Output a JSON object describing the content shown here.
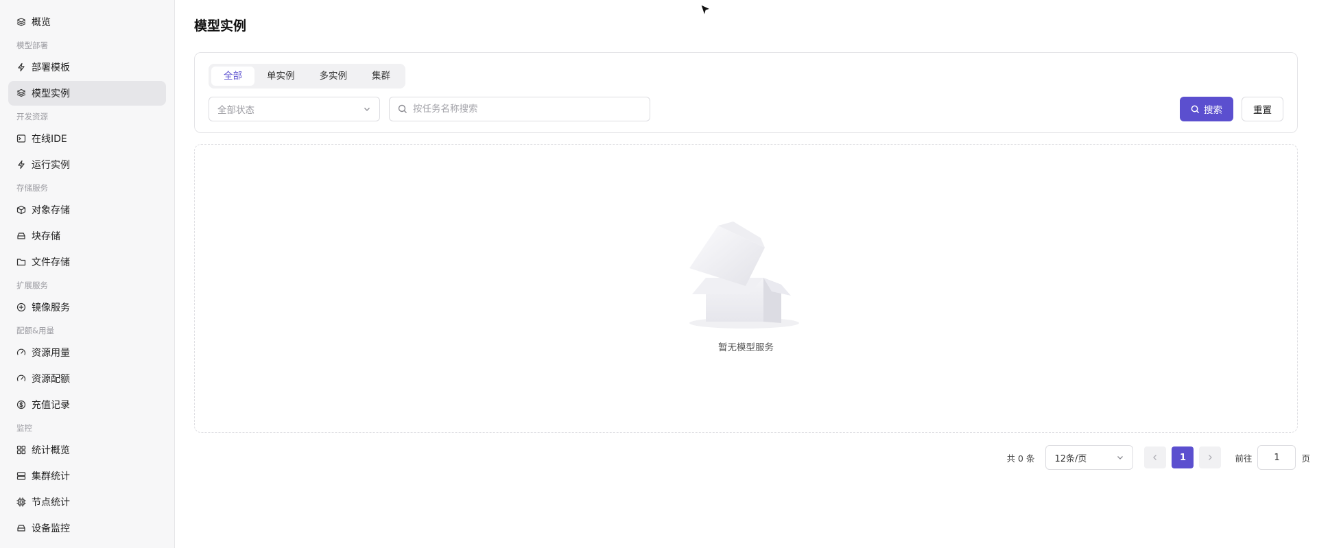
{
  "sidebar": {
    "items": [
      {
        "type": "item",
        "label": "概览",
        "icon": "layers-icon",
        "name": "sidebar-item-overview",
        "active": false
      },
      {
        "type": "group",
        "label": "模型部署"
      },
      {
        "type": "item",
        "label": "部署模板",
        "icon": "lightning-icon",
        "name": "sidebar-item-deploy-template",
        "active": false
      },
      {
        "type": "item",
        "label": "模型实例",
        "icon": "cube-stack-icon",
        "name": "sidebar-item-model-instance",
        "active": true
      },
      {
        "type": "group",
        "label": "开发资源"
      },
      {
        "type": "item",
        "label": "在线IDE",
        "icon": "terminal-icon",
        "name": "sidebar-item-online-ide",
        "active": false
      },
      {
        "type": "item",
        "label": "运行实例",
        "icon": "lightning-icon",
        "name": "sidebar-item-run-instance",
        "active": false
      },
      {
        "type": "group",
        "label": "存储服务"
      },
      {
        "type": "item",
        "label": "对象存储",
        "icon": "box-icon",
        "name": "sidebar-item-object-storage",
        "active": false
      },
      {
        "type": "item",
        "label": "块存储",
        "icon": "hard-drive-icon",
        "name": "sidebar-item-block-storage",
        "active": false
      },
      {
        "type": "item",
        "label": "文件存储",
        "icon": "folder-icon",
        "name": "sidebar-item-file-storage",
        "active": false
      },
      {
        "type": "group",
        "label": "扩展服务"
      },
      {
        "type": "item",
        "label": "镜像服务",
        "icon": "plus-circle-icon",
        "name": "sidebar-item-image-service",
        "active": false
      },
      {
        "type": "group",
        "label": "配额&用量"
      },
      {
        "type": "item",
        "label": "资源用量",
        "icon": "gauge-icon",
        "name": "sidebar-item-resource-usage",
        "active": false
      },
      {
        "type": "item",
        "label": "资源配额",
        "icon": "gauge-icon",
        "name": "sidebar-item-resource-quota",
        "active": false
      },
      {
        "type": "item",
        "label": "充值记录",
        "icon": "dollar-circle-icon",
        "name": "sidebar-item-recharge-records",
        "active": false
      },
      {
        "type": "group",
        "label": "监控"
      },
      {
        "type": "item",
        "label": "统计概览",
        "icon": "grid-icon",
        "name": "sidebar-item-stats-overview",
        "active": false
      },
      {
        "type": "item",
        "label": "集群统计",
        "icon": "server-icon",
        "name": "sidebar-item-cluster-stats",
        "active": false
      },
      {
        "type": "item",
        "label": "节点统计",
        "icon": "cpu-icon",
        "name": "sidebar-item-node-stats",
        "active": false
      },
      {
        "type": "item",
        "label": "设备监控",
        "icon": "hard-drive-icon",
        "name": "sidebar-item-device-monitor",
        "active": false
      }
    ]
  },
  "page": {
    "title": "模型实例"
  },
  "filters": {
    "tabs": [
      {
        "label": "全部",
        "active": true
      },
      {
        "label": "单实例",
        "active": false
      },
      {
        "label": "多实例",
        "active": false
      },
      {
        "label": "集群",
        "active": false
      }
    ],
    "status_select": "全部状态",
    "search_placeholder": "按任务名称搜索",
    "search_button": "搜索",
    "reset_button": "重置"
  },
  "empty": {
    "text": "暂无模型服务"
  },
  "pagination": {
    "total": "共 0 条",
    "page_size": "12条/页",
    "current_page": "1",
    "goto_label": "前往",
    "goto_value": "1",
    "goto_suffix": "页"
  },
  "colors": {
    "accent": "#5b4fcf",
    "sidebar_bg": "#f7f7f8",
    "active_item_bg": "#e6e6e9"
  }
}
